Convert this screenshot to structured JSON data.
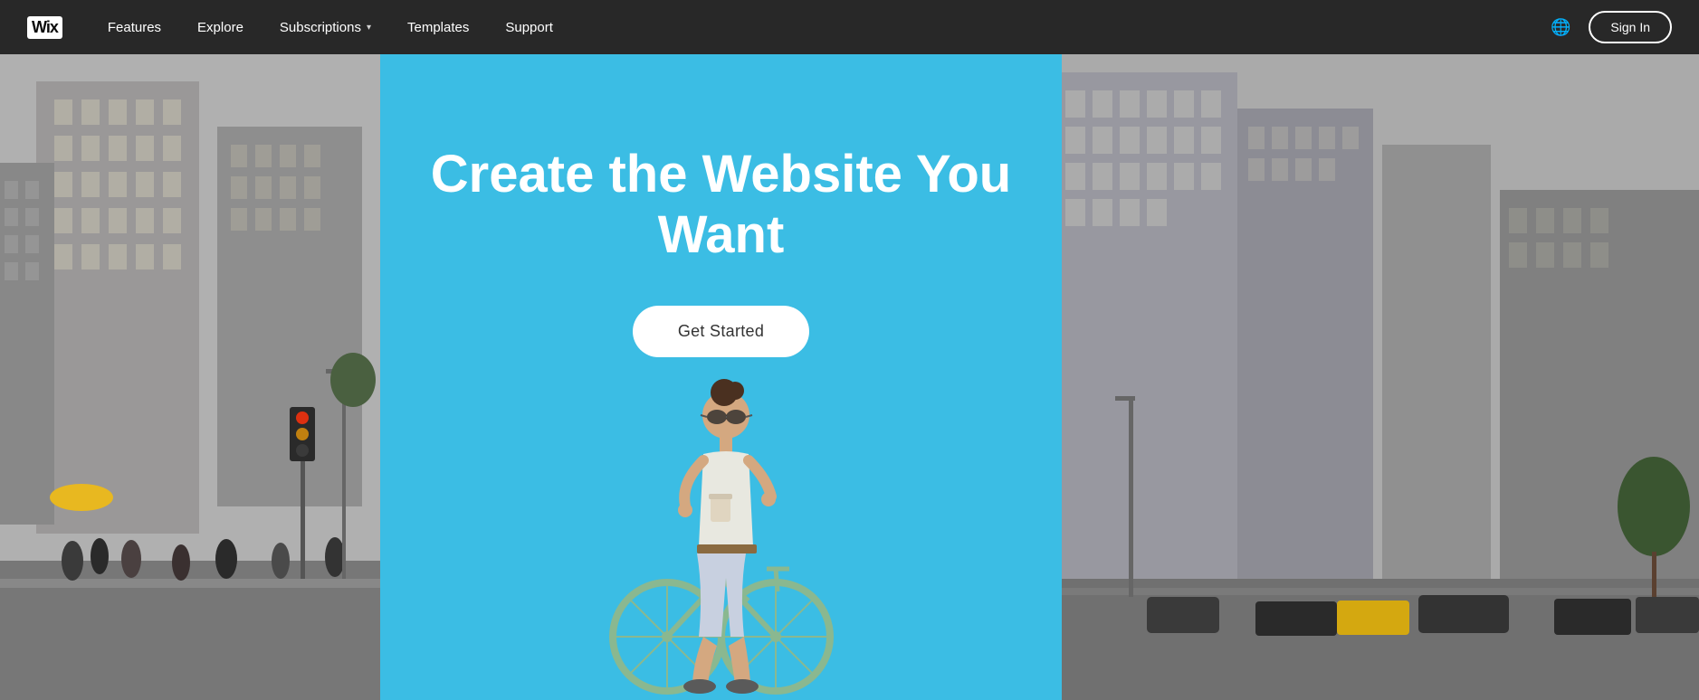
{
  "navbar": {
    "logo_text": "WiX",
    "items": [
      {
        "label": "Features",
        "has_dropdown": false
      },
      {
        "label": "Explore",
        "has_dropdown": false
      },
      {
        "label": "Subscriptions",
        "has_dropdown": true
      },
      {
        "label": "Templates",
        "has_dropdown": false
      },
      {
        "label": "Support",
        "has_dropdown": false
      }
    ],
    "sign_in_label": "Sign In",
    "globe_symbol": "🌐"
  },
  "hero": {
    "title": "Create the Website You Want",
    "cta_label": "Get Started",
    "bg_color": "#3bbde4"
  },
  "colors": {
    "navbar_bg": "rgba(0,0,0,0.55)",
    "hero_bg": "#3bbde4",
    "hero_title_color": "#ffffff",
    "cta_bg": "#ffffff",
    "cta_text": "#333333",
    "sign_in_border": "#ffffff",
    "sign_in_text": "#ffffff"
  }
}
